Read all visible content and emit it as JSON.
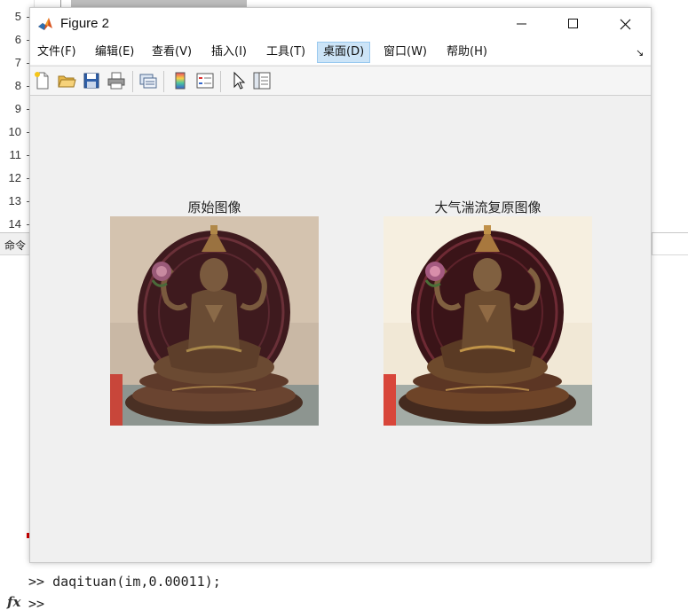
{
  "editor": {
    "line_numbers": [
      "5",
      "6",
      "7",
      "8",
      "9",
      "10",
      "11",
      "12",
      "13",
      "14"
    ]
  },
  "command_window": {
    "header_label": "命令",
    "lines": [
      ">> daqituan(im,0.00011);",
      ">>"
    ],
    "fx_label": "fx"
  },
  "figure": {
    "title": "Figure 2",
    "window_buttons": {
      "minimize": "—",
      "maximize": "☐",
      "close": "✕"
    },
    "menu": [
      "文件(F)",
      "编辑(E)",
      "查看(V)",
      "插入(I)",
      "工具(T)",
      "桌面(D)",
      "窗口(W)",
      "帮助(H)"
    ],
    "active_menu": "桌面(D)",
    "toolbar_icons": [
      "new-figure-icon",
      "open-file-icon",
      "save-icon",
      "print-icon",
      "link-plot-icon",
      "insert-colorbar-icon",
      "insert-legend-icon",
      "pointer-icon",
      "property-inspector-icon"
    ],
    "axes": [
      {
        "title": "原始图像",
        "image": "buddha-statue-original"
      },
      {
        "title": "大气湍流复原图像",
        "image": "buddha-statue-restored"
      }
    ]
  },
  "colors": {
    "active_menu_bg": "#cce4f7",
    "figure_bg": "#f0f0f0",
    "statue_bronze": "#5a3a24",
    "halo_maroon": "#4a1a22"
  }
}
